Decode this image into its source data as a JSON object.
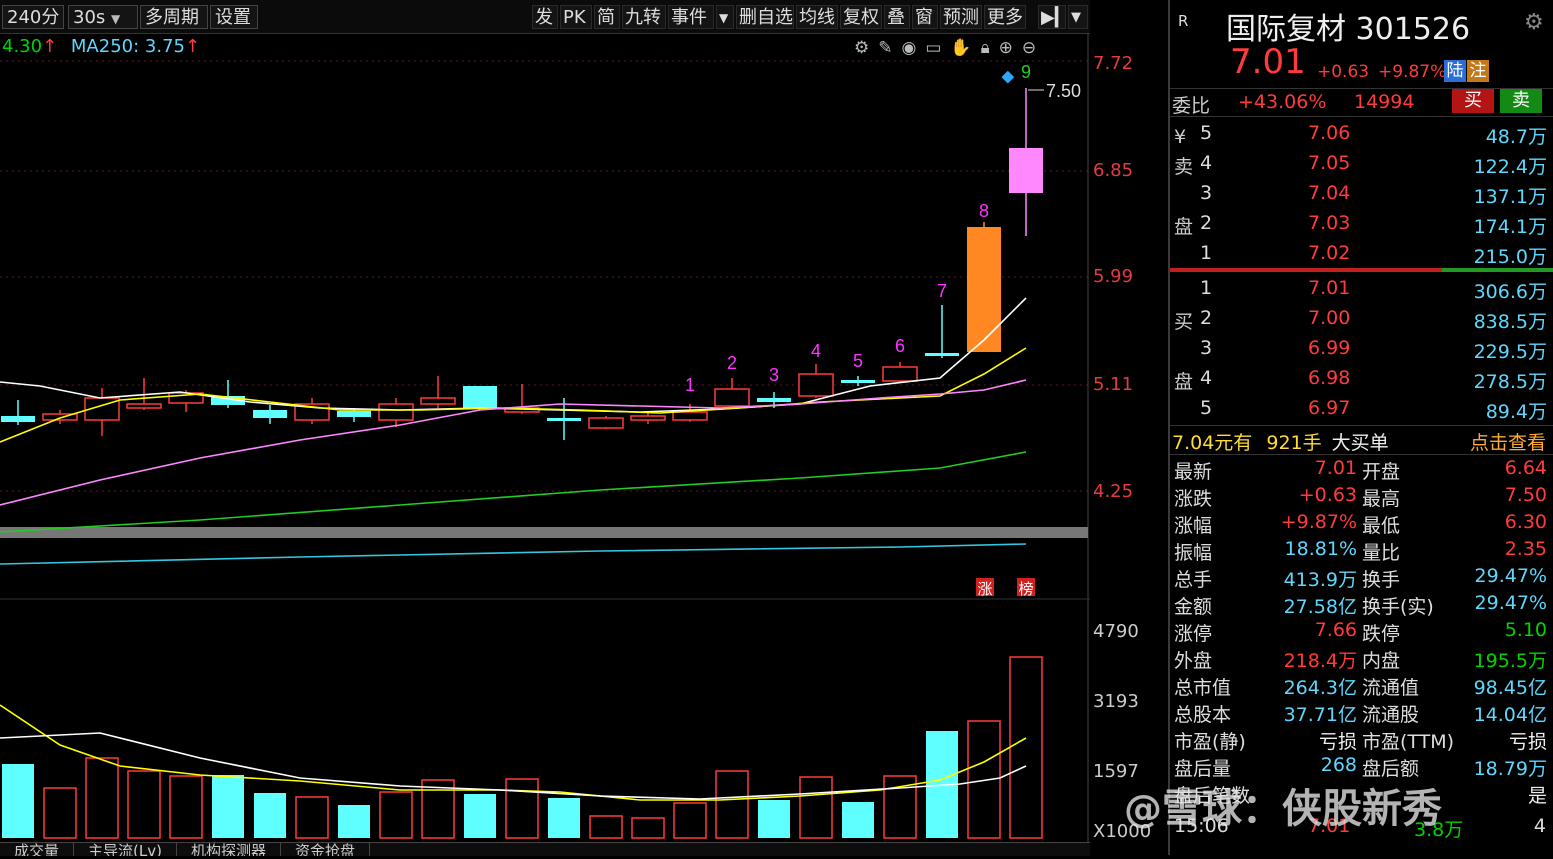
{
  "toolbar": {
    "period": "240分",
    "interval": "30s",
    "multi_period": "多周期",
    "settings": "设置",
    "right_buttons": [
      "发",
      "PK",
      "简",
      "九转",
      "事件",
      "删自选",
      "均线",
      "复权",
      "叠",
      "窗",
      "预测",
      "更多"
    ]
  },
  "chart": {
    "indicator_value": "4.30",
    "ma250_label": "MA250: 3.75",
    "price_axis": [
      "7.72",
      "6.85",
      "5.99",
      "5.11",
      "4.25"
    ],
    "volume_axis": [
      "4790",
      "3193",
      "1597",
      "X1000"
    ],
    "high_marker": "7.50",
    "count_labels": [
      "1",
      "2",
      "3",
      "4",
      "5",
      "6",
      "7",
      "8",
      "9"
    ],
    "badges": [
      "涨",
      "榜"
    ],
    "bottom_tabs": [
      "成交量",
      "主导流(Lv)",
      "机构探测器",
      "资金抢盘"
    ],
    "colors": {
      "up": "#ff3b3b",
      "down": "#5fffff",
      "ma5": "#ffffff",
      "ma10": "#ffff00",
      "ma20": "#ff88ff",
      "ma60": "#22cc22",
      "ma250": "#33c8e0"
    }
  },
  "panel": {
    "marker": "R",
    "name": "国际复材",
    "code": "301526",
    "price": "7.01",
    "change": "+0.63",
    "change_pct": "+9.87%",
    "tag_lu": "陆",
    "tag_zhu": "注",
    "weibi_label": "委比",
    "weibi_value": "+43.06%",
    "weicha": "14994",
    "buy_btn": "买",
    "sell_btn": "卖",
    "sell_side_label": [
      "¥",
      "卖",
      "盘"
    ],
    "buy_side_label": [
      "买",
      "盘"
    ],
    "asks": [
      {
        "level": "5",
        "price": "7.06",
        "volume": "48.7万"
      },
      {
        "level": "4",
        "price": "7.05",
        "volume": "122.4万"
      },
      {
        "level": "3",
        "price": "7.04",
        "volume": "137.1万"
      },
      {
        "level": "2",
        "price": "7.03",
        "volume": "174.1万"
      },
      {
        "level": "1",
        "price": "7.02",
        "volume": "215.0万"
      }
    ],
    "bids": [
      {
        "level": "1",
        "price": "7.01",
        "volume": "306.6万"
      },
      {
        "level": "2",
        "price": "7.00",
        "volume": "838.5万"
      },
      {
        "level": "3",
        "price": "6.99",
        "volume": "229.5万"
      },
      {
        "level": "4",
        "price": "6.98",
        "volume": "278.5万"
      },
      {
        "level": "5",
        "price": "6.97",
        "volume": "89.4万"
      }
    ],
    "big_order": {
      "price": "7.04元有",
      "hands": "921手",
      "text": "大买单",
      "link": "点击查看"
    },
    "stats": [
      {
        "l1": "最新",
        "v1": "7.01",
        "c1": "red",
        "l2": "开盘",
        "v2": "6.64",
        "c2": "red"
      },
      {
        "l1": "涨跌",
        "v1": "+0.63",
        "c1": "red",
        "l2": "最高",
        "v2": "7.50",
        "c2": "red"
      },
      {
        "l1": "涨幅",
        "v1": "+9.87%",
        "c1": "red",
        "l2": "最低",
        "v2": "6.30",
        "c2": "red"
      },
      {
        "l1": "振幅",
        "v1": "18.81%",
        "c1": "cyan",
        "l2": "量比",
        "v2": "2.35",
        "c2": "red"
      },
      {
        "l1": "总手",
        "v1": "413.9万",
        "c1": "cyan",
        "l2": "换手",
        "v2": "29.47%",
        "c2": "cyan"
      },
      {
        "l1": "金额",
        "v1": "27.58亿",
        "c1": "cyan",
        "l2": "换手(实)",
        "v2": "29.47%",
        "c2": "cyan"
      },
      {
        "l1": "涨停",
        "v1": "7.66",
        "c1": "red",
        "l2": "跌停",
        "v2": "5.10",
        "c2": "green"
      },
      {
        "l1": "外盘",
        "v1": "218.4万",
        "c1": "red",
        "l2": "内盘",
        "v2": "195.5万",
        "c2": "green"
      },
      {
        "l1": "总市值",
        "v1": "264.3亿",
        "c1": "cyan",
        "l2": "流通值",
        "v2": "98.45亿",
        "c2": "cyan"
      },
      {
        "l1": "总股本",
        "v1": "37.71亿",
        "c1": "cyan",
        "l2": "流通股",
        "v2": "14.04亿",
        "c2": "cyan"
      },
      {
        "l1": "市盈(静)",
        "v1": "亏损",
        "c1": "white",
        "l2": "市盈(TTM)",
        "v2": "亏损",
        "c2": "white"
      },
      {
        "l1": "盘后量",
        "v1": "268",
        "c1": "cyan",
        "l2": "盘后额",
        "v2": "18.79万",
        "c2": "cyan"
      },
      {
        "l1": "盘后笔数",
        "v1": "",
        "c1": "cyan",
        "l2": "",
        "v2": "是",
        "c2": "white"
      }
    ],
    "tick": {
      "time": "15:06",
      "price": "7.01",
      "volume": "3.8万",
      "count": "4"
    },
    "watermark": "雪球：侠股新秀"
  }
}
